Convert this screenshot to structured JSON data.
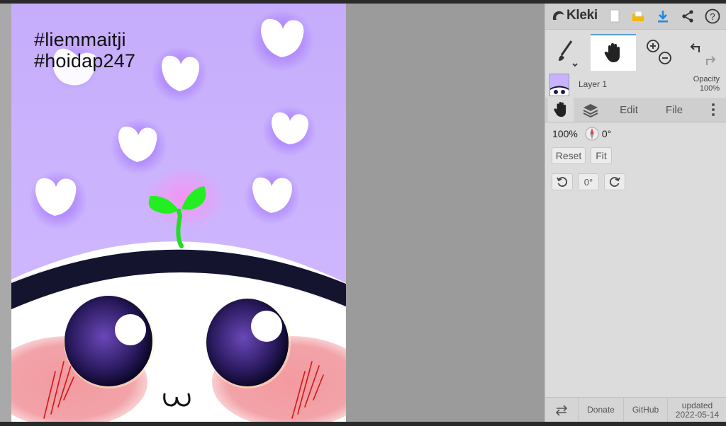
{
  "canvas": {
    "hashtag_1": "#liemmaitji",
    "hashtag_2": "#hoidap247",
    "colors": {
      "background": "#c9b2ff",
      "band": "#14142e",
      "sprout": "#22dd22",
      "blush": "#f2a0a6",
      "eye": "#241458"
    }
  },
  "header": {
    "logo_text": "Kleki",
    "icons": [
      "new-page-icon",
      "open-folder-icon",
      "download-icon",
      "share-icon",
      "help-icon"
    ]
  },
  "tools": {
    "icons": [
      "brush-icon",
      "hand-icon",
      "zoom-in-icon",
      "zoom-out-icon",
      "undo-icon",
      "redo-icon"
    ]
  },
  "layer": {
    "name": "Layer 1",
    "opacity_label": "Opacity",
    "opacity_value": "100%"
  },
  "tabs": {
    "edit": "Edit",
    "file": "File"
  },
  "view": {
    "zoom": "100%",
    "rotation": "0°",
    "reset": "Reset",
    "fit": "Fit",
    "rotate_value": "0°"
  },
  "footer": {
    "donate": "Donate",
    "github": "GitHub",
    "updated_label": "updated",
    "updated_date": "2022-05-14"
  },
  "accent": "#1e88e5"
}
